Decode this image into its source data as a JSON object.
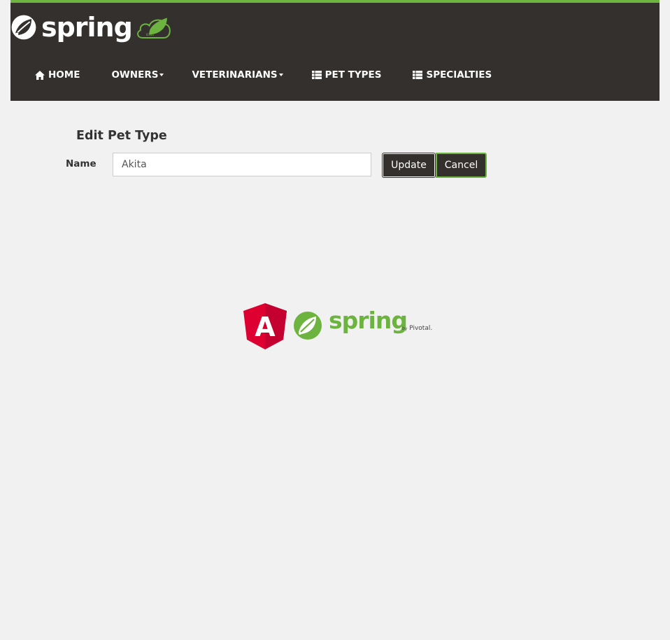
{
  "brand": {
    "name": "spring",
    "badge_icon": "leaf-cloud-icon",
    "badge_text": "0101"
  },
  "nav": {
    "items": [
      {
        "label": "HOME",
        "icon": "home-icon"
      },
      {
        "label": "OWNERS",
        "dropdown": true
      },
      {
        "label": "VETERINARIANS",
        "dropdown": true
      },
      {
        "label": "PET TYPES",
        "icon": "list-icon"
      },
      {
        "label": "SPECIALTIES",
        "icon": "list-icon"
      }
    ]
  },
  "form": {
    "title": "Edit Pet Type",
    "name_label": "Name",
    "name_value": "Akita",
    "update_label": "Update",
    "cancel_label": "Cancel"
  },
  "footer": {
    "angular_logo_letter": "A",
    "spring_text": "spring",
    "pivotal_prefix": "by",
    "pivotal_text": "Pivotal."
  },
  "colors": {
    "navbar": "#34302d",
    "accent_green": "#6db33f",
    "page_bg": "#f1f1f1",
    "angular_red": "#dd0031"
  }
}
